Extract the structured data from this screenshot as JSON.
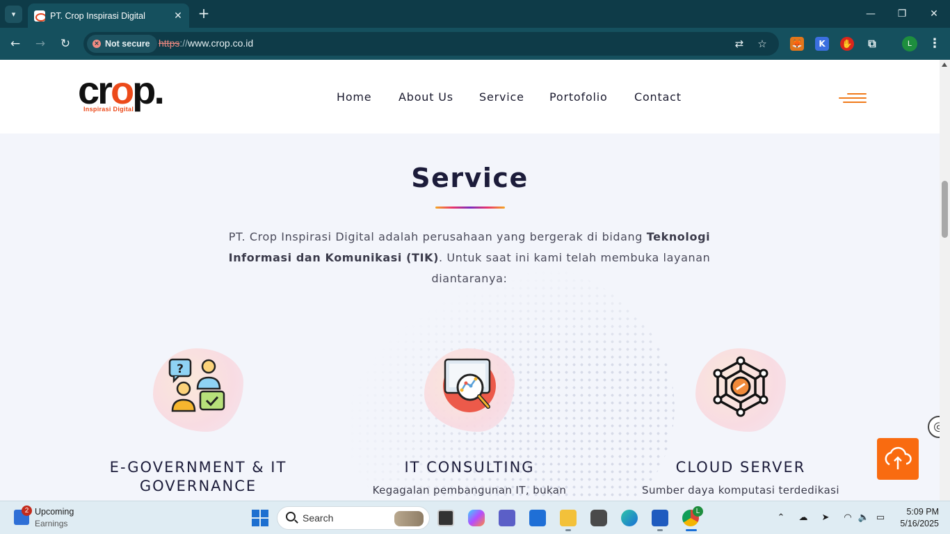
{
  "browser": {
    "tab_title": "PT. Crop Inspirasi Digital",
    "tab_close": "✕",
    "new_tab": "+",
    "security_label": "Not secure",
    "url_scheme": "https",
    "url_separator": "://",
    "url_host": "www.crop.co.id",
    "profile_initial": "L",
    "extensions": [
      "metamask-icon",
      "k-extension-icon",
      "adblock-icon",
      "puzzle-extensions-icon"
    ]
  },
  "site": {
    "logo_text_c": "c",
    "logo_text_r": "r",
    "logo_text_o": "o",
    "logo_text_p": "p.",
    "logo_tagline": "Inspirasi Digital",
    "nav": [
      "Home",
      "About Us",
      "Service",
      "Portofolio",
      "Contact"
    ],
    "accent_color": "#f96b10"
  },
  "service_section": {
    "title": "Service",
    "intro_part1": "PT. Crop Inspirasi Digital adalah perusahaan yang bergerak di bidang ",
    "intro_bold": "Teknologi Informasi dan Komunikasi (TIK)",
    "intro_part2": ". Untuk saat ini kami telah membuka layanan diantaranya:",
    "cards": [
      {
        "title_line1": "E-GOVERNMENT & IT",
        "title_line2": "GOVERNANCE",
        "description": "",
        "icon": "people-question-icon"
      },
      {
        "title_line1": "IT CONSULTING",
        "title_line2": "",
        "description": "Kegagalan pembangunan IT, bukan",
        "icon": "monitor-magnifier-icon"
      },
      {
        "title_line1": "CLOUD SERVER",
        "title_line2": "",
        "description": "Sumber daya komputasi terdedikasi",
        "icon": "network-link-icon"
      }
    ]
  },
  "taskbar": {
    "weather_badge": "2",
    "weather_title": "Upcoming",
    "weather_subtitle": "Earnings",
    "search_placeholder": "Search",
    "clock_time": "5:09 PM",
    "clock_date": "5/16/2025",
    "profile_badge": "L"
  }
}
